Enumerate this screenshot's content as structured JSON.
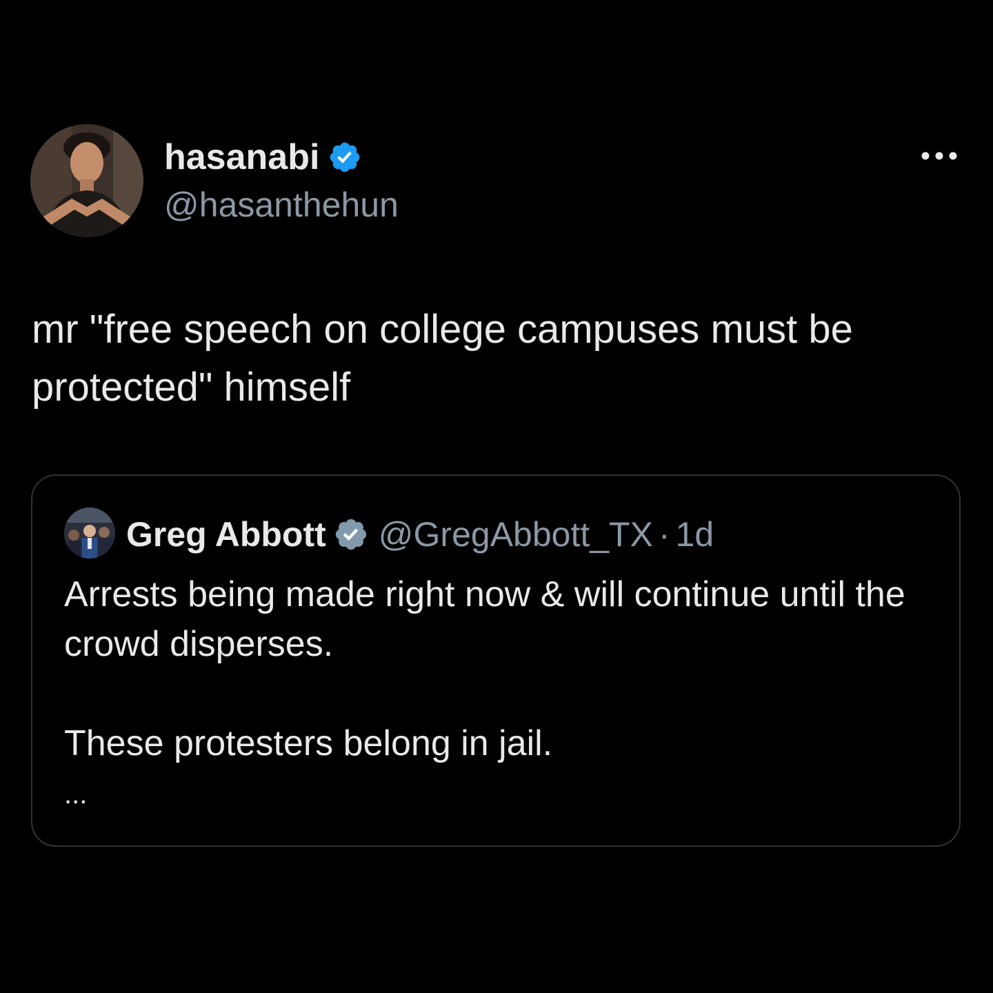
{
  "tweet": {
    "author": {
      "display_name": "hasanabi",
      "handle": "@hasanthehun",
      "verified": true,
      "verified_color": "#1d9bf0"
    },
    "more_icon": "more-horizontal-icon",
    "text": "mr \"free speech on college campuses must be protected\" himself",
    "quoted": {
      "display_name": "Greg Abbott",
      "verified": true,
      "verified_color": "#829aab",
      "handle": "@GregAbbott_TX",
      "separator": "·",
      "time": "1d",
      "paragraphs": [
        "Arrests being made right now & will continue until the crowd disperses.",
        "These protesters belong in jail."
      ],
      "truncation": "..."
    }
  }
}
